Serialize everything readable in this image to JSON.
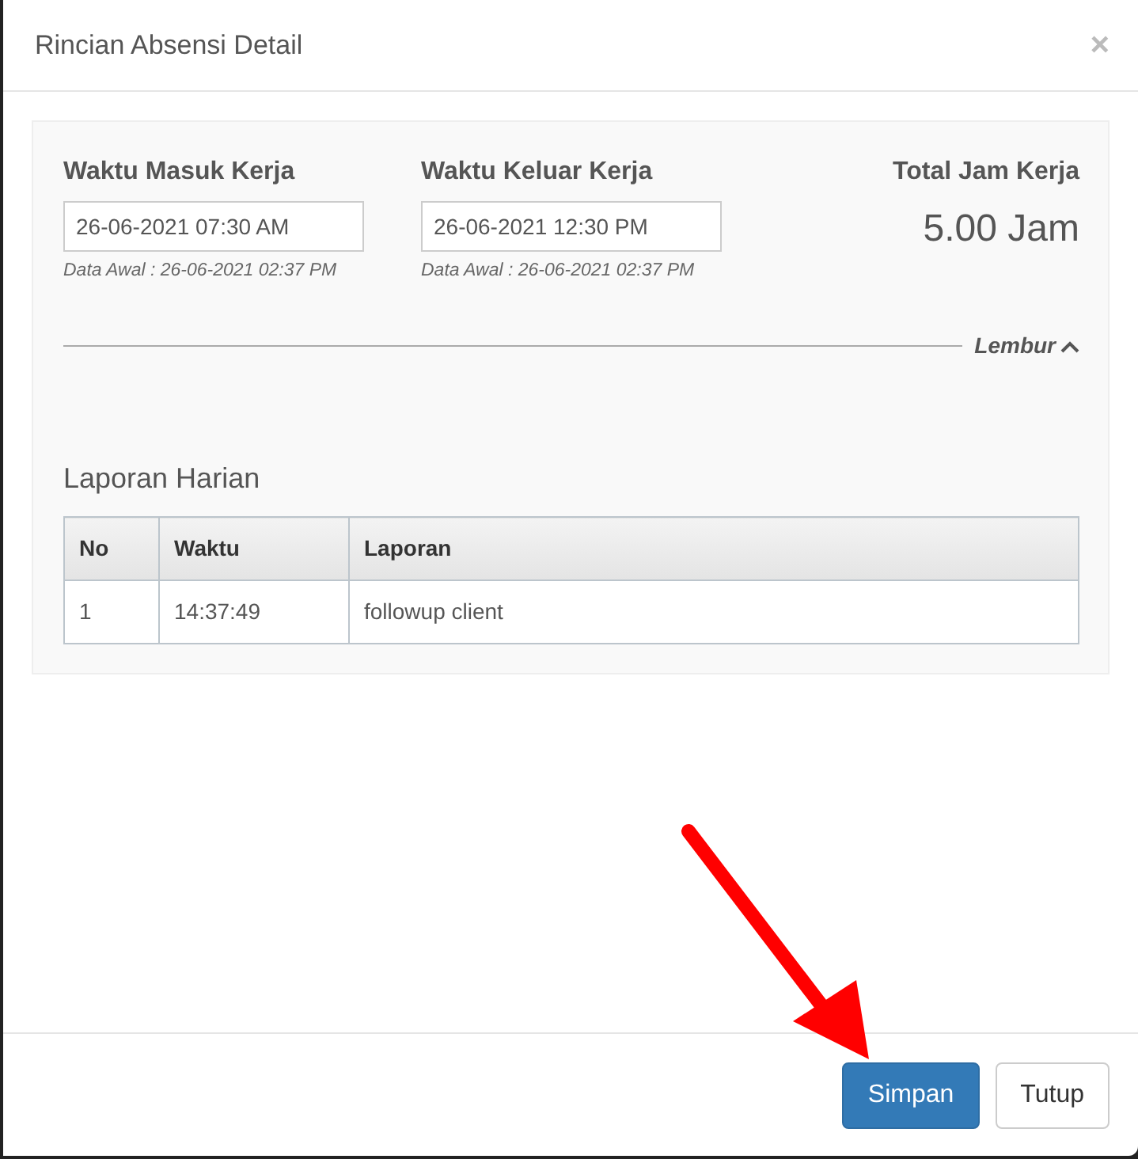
{
  "window": {
    "title": "Rincian Absensi Detail",
    "close": "×"
  },
  "fields": [
    {
      "label": "Waktu Masuk Kerja",
      "value": "26-06-2021 07:30 AM",
      "note": "Data Awal : 26-06-2021 02:37 PM"
    },
    {
      "label": "Waktu Keluar Kerja",
      "value": "26-06-2021 12:30 PM",
      "note": "Data Awal : 26-06-2021 02:37 PM"
    }
  ],
  "total": {
    "label": "Total Jam Kerja",
    "value": "5.00 Jam"
  },
  "overtime": {
    "label": "Lembur",
    "expanded": true
  },
  "report": {
    "title": "Laporan Harian",
    "columns": [
      "No",
      "Waktu",
      "Laporan"
    ],
    "rows": [
      [
        "1",
        "14:37:49",
        "followup client"
      ]
    ]
  },
  "buttons": [
    {
      "label": "Simpan",
      "kind": "primary"
    },
    {
      "label": "Tutup",
      "kind": "default"
    }
  ]
}
